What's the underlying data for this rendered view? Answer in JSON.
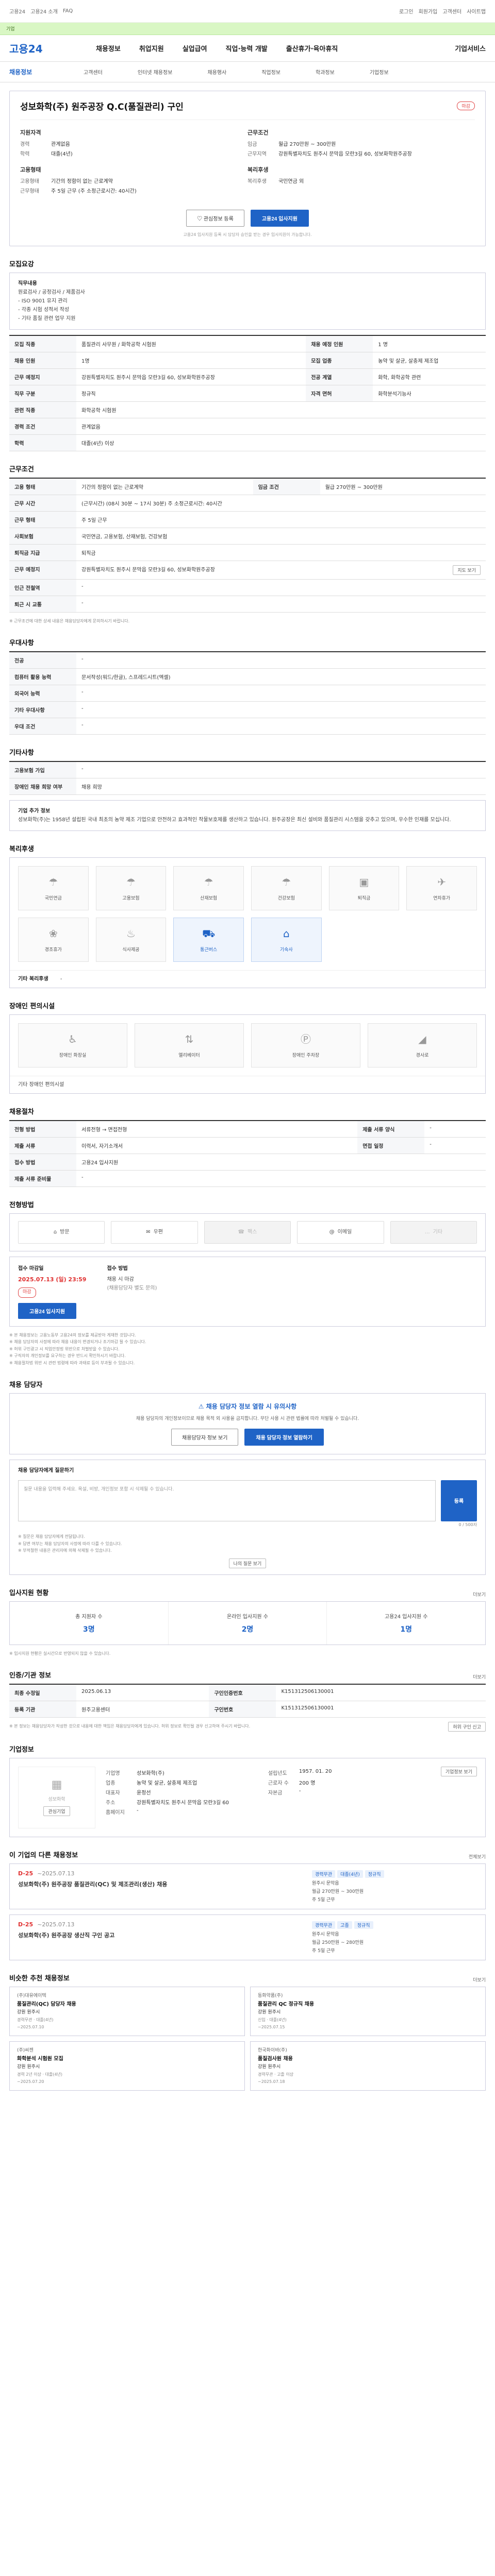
{
  "topbar": {
    "left_links": [
      "고용24",
      "고용24 소개",
      "FAQ"
    ],
    "right_links": [
      "로그인",
      "회원가입",
      "고객센터",
      "사이트맵"
    ]
  },
  "banner": {
    "text": "기업"
  },
  "gnb": {
    "logo": "고용24",
    "menus": [
      "채용정보",
      "취업지원",
      "실업급여",
      "직업·능력 개발",
      "출산휴가·육아휴직"
    ],
    "right": "기업서비스"
  },
  "subnav": {
    "home": "채용정보",
    "items": [
      "고객센터",
      "인터넷 채용정보",
      "채용행사",
      "직업정보",
      "학과정보",
      "기업정보"
    ]
  },
  "job": {
    "company": "성보화학(주) 원주공장 Q.C(품질관리) 구인",
    "status": "마감",
    "left_title": "지원자격",
    "right_title": "근무조건",
    "left_kv": [
      {
        "k": "경력",
        "v": "관계없음"
      },
      {
        "k": "학력",
        "v": "대졸(4년)"
      }
    ],
    "left_kv2_title": "고용형태",
    "left_kv2": [
      {
        "k": "고용형태",
        "v": "기간의 정함이 없는 근로계약"
      },
      {
        "k": "근무형태",
        "v": "주 5일 근무 (주 소정근로시간: 40시간)"
      }
    ],
    "right_kv": [
      {
        "k": "임금",
        "v": "월급 270만원 ~ 300만원"
      },
      {
        "k": "근무지역",
        "v": "강원특별자치도 원주시 문막읍 모란3길 60, 성보화학원주공장"
      }
    ],
    "right_kv2_title": "복리후생",
    "right_kv2": [
      {
        "k": "복리후생",
        "v": "국민연금 외"
      }
    ],
    "btn_interest": "관심정보 등록",
    "btn_apply": "고용24 입사지원",
    "notice": "고용24 입사지원 등록 시 담당자 승인을 받는 경우 입사지원이 가능합니다."
  },
  "recruit": {
    "title": "모집요강",
    "body_title": "직무내용",
    "body_lines": [
      "원료검사 / 공정검사 / 제품검사",
      "- ISO 9001 유지 관리",
      "- 각종 시험 성적서 작성",
      "- 기타 품질 관련 업무 지원"
    ],
    "rows": [
      {
        "th": "모집 직종",
        "v": "품질관리 사무원 / 화학공학 시험원"
      },
      {
        "th": "채용 인원",
        "v": "1명"
      },
      {
        "th": "근무 예정지",
        "v": "강원특별자치도 원주시 문막읍 모란3길 60, 성보화학원주공장"
      },
      {
        "th": "직무 구분",
        "v": "정규직"
      },
      {
        "th": "관련 직종",
        "v": "화학공학 시험원"
      },
      {
        "th": "경력 조건",
        "v": "관계없음"
      },
      {
        "th": "학력",
        "v": "대졸(4년) 이상"
      }
    ],
    "side_rows": [
      {
        "th": "채용 예정 인원",
        "v": "1 명"
      },
      {
        "th": "모집 업종",
        "v": "농약 및 살균, 살충제 제조업"
      },
      {
        "th": "전공 계열",
        "v": "화학, 화학공학 관련"
      },
      {
        "th": "자격 면허",
        "v": "화학분석기능사"
      }
    ]
  },
  "conditions": {
    "title": "근무조건",
    "rows": [
      {
        "th": "고용 형태",
        "v": "기간의 정함이 없는 근로계약",
        "th2": "임금 조건",
        "v2": "월급 270만원 ~ 300만원"
      },
      {
        "th": "근무 시간",
        "v": "(근무시간) (08시 30분 ~ 17시 30분) 주 소정근로시간: 40시간"
      },
      {
        "th": "근무 형태",
        "v": "주 5일 근무"
      },
      {
        "th": "사회보험",
        "v": "국민연금, 고용보험, 산재보험, 건강보험"
      },
      {
        "th": "퇴직금 지급",
        "v": "퇴직금"
      },
      {
        "th": "근무 예정지",
        "v": "강원특별자치도 원주시 문막읍 모란3길 60, 성보화학원주공장"
      },
      {
        "th": "인근 전철역",
        "v": "-"
      },
      {
        "th": "퇴근 시 교통",
        "v": "-"
      }
    ],
    "map_btn": "지도 보기",
    "foot": "※ 근무조건에 대한 상세 내용은 채용담당자에게 문의하시기 바랍니다."
  },
  "preferred": {
    "title": "우대사항",
    "rows": [
      {
        "th": "전공",
        "v": "-"
      },
      {
        "th": "컴퓨터 활용 능력",
        "v": "문서작성(워드/한글), 스프레드시트(엑셀)"
      },
      {
        "th": "외국어 능력",
        "v": "-"
      },
      {
        "th": "기타 우대사항",
        "v": "-"
      },
      {
        "th": "우대 조건",
        "v": "-"
      }
    ]
  },
  "extra": {
    "title": "기타사항",
    "rows": [
      {
        "th": "고용보험 가입",
        "v": "-"
      },
      {
        "th": "장애인 채용 희망 여부",
        "v": "채용 희망"
      }
    ],
    "company_intro_title": "기업 추가 정보",
    "company_intro": "성보화학(주)는 1958년 설립된 국내 최초의 농약 제조 기업으로 안전하고 효과적인 작물보호제를 생산하고 있습니다. 원주공장은 최신 설비와 품질관리 시스템을 갖추고 있으며, 우수한 인재를 모십니다."
  },
  "welfare": {
    "title": "복리후생",
    "items": [
      "국민연금",
      "고용보험",
      "산재보험",
      "건강보험",
      "퇴직금",
      "연차휴가",
      "경조휴가",
      "식사제공",
      "통근버스",
      "기숙사"
    ],
    "active": [
      8,
      9
    ],
    "more": "기타 복리후생",
    "more_value": "-"
  },
  "disability": {
    "title": "장애인 편의시설",
    "items": [
      "장애인 화장실",
      "엘리베이터",
      "장애인 주차장",
      "경사로"
    ],
    "foot": "기타 장애인 편의시설"
  },
  "selection": {
    "title": "채용절차",
    "rows": [
      {
        "th": "전형 방법",
        "v": "서류전형 → 면접전형"
      },
      {
        "th": "제출 서류",
        "v": "이력서, 자기소개서"
      },
      {
        "th": "접수 방법",
        "v": "고용24 입사지원"
      },
      {
        "th": "제출 서류 준비물",
        "v": "-"
      }
    ],
    "side_rows": [
      {
        "th": "제출 서류 양식",
        "v": "-"
      },
      {
        "th": "면접 일정",
        "v": "-"
      }
    ]
  },
  "apply_method": {
    "title": "전형방법",
    "methods": [
      "방문",
      "우편",
      "팩스",
      "이메일",
      "기타"
    ],
    "enabled": [
      0,
      1,
      3
    ]
  },
  "deadline": {
    "reg_label": "접수 마감일",
    "reg_value": "2025.07.13 (일) 23:59",
    "reg_badge": "마감",
    "apply_label": "접수 방법",
    "apply_value": "채용 시 마감",
    "apply_note": "(채용담당자 별도 문의)",
    "apply_button": "고용24 입사지원",
    "notes": [
      "※ 본 채용정보는 고용노동부 고용24의 정보를 제공받아 게재한 것입니다.",
      "※ 채용 담당자의 사정에 따라 채용 내용이 변경되거나 조기마감 될 수 있습니다.",
      "※ 허위 구인광고 시 직업안정법 위반으로 처벌받을 수 있습니다.",
      "※ 구직자의 개인정보를 요구하는 경우 반드시 확인하시기 바랍니다.",
      "※ 채용절차법 위반 시 관련 법령에 따라 과태료 등이 부과될 수 있습니다."
    ]
  },
  "contact": {
    "title": "채용 담당자",
    "banner": "채용 담당자 정보 열람 시 유의사항",
    "banner_sub": "채용 담당자의 개인정보이므로 채용 목적 외 사용을 금지합니다. 무단 사용 시 관련 법률에 따라 처벌될 수 있습니다.",
    "btn_show": "채용담당자 정보 보기",
    "btn_apply": "채용 담당자 정보 열람하기",
    "question_title": "채용 담당자에게 질문하기",
    "question_placeholder": "질문 내용을 입력해 주세요. 욕설, 비방, 개인정보 포함 시 삭제될 수 있습니다.",
    "question_counter": "0 / 500자",
    "question_submit": "등록",
    "question_notes": [
      "※ 질문은 채용 담당자에게 전달됩니다.",
      "※ 답변 여부는 채용 담당자의 사정에 따라 다를 수 있습니다.",
      "※ 부적절한 내용은 관리자에 의해 삭제될 수 있습니다."
    ],
    "question_link": "나의 질문 보기"
  },
  "status": {
    "title": "입사지원 현황",
    "more": "더보기",
    "counters": [
      {
        "label": "총 지원자 수",
        "value": "3명"
      },
      {
        "label": "온라인 입사지원 수",
        "value": "2명"
      },
      {
        "label": "고용24 입사지원 수",
        "value": "1명"
      }
    ],
    "note": "※ 입사지원 현황은 실시간으로 반영되지 않을 수 있습니다."
  },
  "posting": {
    "title": "인증/기관 정보",
    "more": "더보기",
    "rows": [
      {
        "th": "최종 수정일",
        "v": "2025.06.13",
        "th2": "구인인증번호",
        "v2": "K151312506130001"
      },
      {
        "th": "등록 기관",
        "v": "원주고용센터",
        "th2": "구인번호",
        "v2": "K151312506130001"
      }
    ],
    "note": "※ 본 정보는 채용담당자가 작성한 것으로 내용에 대한 책임은 채용담당자에게 있습니다. 허위 정보로 확인될 경우 신고하여 주시기 바랍니다.",
    "report": "허위 구인 신고"
  },
  "company": {
    "title": "기업정보",
    "logo_text": "성보화학",
    "btn_interest": "관심기업",
    "btn_more": "기업정보 보기",
    "rows": [
      {
        "k": "기업명",
        "v": "성보화학(주)",
        "k2": "설립년도",
        "v2": "1957. 01. 20"
      },
      {
        "k": "업종",
        "v": "농약 및 살균, 살충제 제조업",
        "k2": "근로자 수",
        "v2": "200 명"
      },
      {
        "k": "대표자",
        "v": "윤정선",
        "k2": "자본금",
        "v2": "-"
      },
      {
        "k": "주소",
        "v": "강원특별자치도 원주시 문막읍 모란3길 60",
        "k2": "",
        "v2": ""
      }
    ],
    "homepage_label": "홈페이지",
    "homepage": "-"
  },
  "other_jobs": {
    "title": "이 기업의 다른 채용정보",
    "more": "전체보기",
    "items": [
      {
        "dday": "D-25",
        "date": "~2025.07.13",
        "title": "성보화학(주) 원주공장 품질관리(QC) 및 제조관리(생산) 채용",
        "tags": [
          "경력무관",
          "대졸(4년)",
          "정규직"
        ],
        "info": [
          "원주시 문막읍",
          "월급 270만원 ~ 300만원",
          "주 5일 근무"
        ]
      },
      {
        "dday": "D-25",
        "date": "~2025.07.13",
        "title": "성보화학(주) 원주공장 생산직 구인 공고",
        "tags": [
          "경력무관",
          "고졸",
          "정규직"
        ],
        "info": [
          "원주시 문막읍",
          "월급 250만원 ~ 280만원",
          "주 5일 근무"
        ]
      }
    ]
  },
  "recommend": {
    "title": "비슷한 추천 채용정보",
    "more": "더보기",
    "items": [
      {
        "company": "(주)대유에이텍",
        "title": "품질관리(QC) 담당자 채용",
        "region": "강원 원주시",
        "cond": "경력무관 · 대졸(4년)",
        "date": "~2025.07.10"
      },
      {
        "company": "동화약품(주)",
        "title": "품질관리 QC 정규직 채용",
        "region": "강원 원주시",
        "cond": "신입 · 대졸(4년)",
        "date": "~2025.07.15"
      },
      {
        "company": "(주)씨젠",
        "title": "화학분석 시험원 모집",
        "region": "강원 원주시",
        "cond": "경력 2년 이상 · 대졸(4년)",
        "date": "~2025.07.20"
      },
      {
        "company": "한국화이바(주)",
        "title": "품질검사원 채용",
        "region": "강원 원주시",
        "cond": "경력무관 · 고졸 이상",
        "date": "~2025.07.18"
      }
    ]
  }
}
